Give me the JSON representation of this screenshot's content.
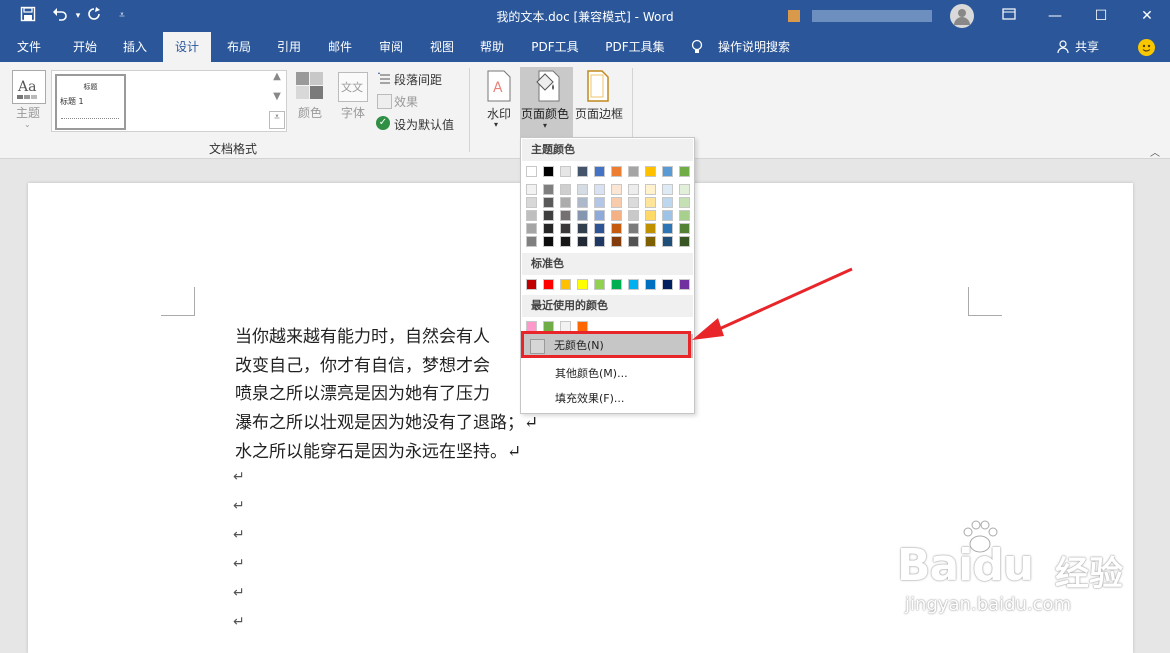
{
  "titlebar": {
    "title": "我的文本.doc [兼容模式] - Word",
    "save_icon": "save-icon",
    "undo_icon": "undo-icon",
    "redo_icon": "redo-icon",
    "customize_icon": "customize-qat-icon"
  },
  "menu": {
    "tabs": [
      "文件",
      "开始",
      "插入",
      "设计",
      "布局",
      "引用",
      "邮件",
      "审阅",
      "视图",
      "帮助",
      "PDF工具",
      "PDF工具集"
    ],
    "active": "设计",
    "tell_me": "操作说明搜索",
    "share": "共享"
  },
  "ribbon": {
    "theme_label": "主题",
    "style_preview_title": "标题",
    "style_preview_heading": "标题 1",
    "colors_label": "颜色",
    "fonts_label": "字体",
    "paragraph_spacing": "段落间距",
    "effects": "效果",
    "set_default": "设为默认值",
    "group_label": "文档格式",
    "watermark": "水印",
    "page_color": "页面颜色",
    "page_borders": "页面边框"
  },
  "dropdown": {
    "theme_colors_header": "主题颜色",
    "standard_colors_header": "标准色",
    "recent_colors_header": "最近使用的颜色",
    "no_color": "无颜色(N)",
    "more_colors": "其他颜色(M)...",
    "fill_effects": "填充效果(F)...",
    "theme_top_row": [
      "#ffffff",
      "#000000",
      "#e7e6e6",
      "#44546a",
      "#4472c4",
      "#ed7d31",
      "#a5a5a5",
      "#ffc000",
      "#5b9bd5",
      "#70ad47"
    ],
    "theme_shades": [
      [
        "#f2f2f2",
        "#d8d8d8",
        "#bfbfbf",
        "#a5a5a5",
        "#7f7f7f"
      ],
      [
        "#7f7f7f",
        "#595959",
        "#3f3f3f",
        "#262626",
        "#0c0c0c"
      ],
      [
        "#d0cece",
        "#aeabab",
        "#757171",
        "#3a3838",
        "#171616"
      ],
      [
        "#d6dce4",
        "#adb9ca",
        "#8496b0",
        "#323f4f",
        "#222a35"
      ],
      [
        "#d9e2f3",
        "#b4c6e7",
        "#8eaadb",
        "#2f5496",
        "#1f3864"
      ],
      [
        "#fbe5d5",
        "#f7cbac",
        "#f4b183",
        "#c55a11",
        "#833c0b"
      ],
      [
        "#ededed",
        "#dbdbdb",
        "#c9c9c9",
        "#7b7b7b",
        "#525252"
      ],
      [
        "#fff2cc",
        "#fee599",
        "#ffd965",
        "#bf9000",
        "#7f6000"
      ],
      [
        "#deebf6",
        "#bdd7ee",
        "#9dc3e6",
        "#2e75b5",
        "#1f4e79"
      ],
      [
        "#e2efd9",
        "#c5e0b3",
        "#a8d08d",
        "#538135",
        "#375623"
      ]
    ],
    "standard_colors": [
      "#c00000",
      "#ff0000",
      "#ffc000",
      "#ffff00",
      "#92d050",
      "#00b050",
      "#00b0f0",
      "#0070c0",
      "#002060",
      "#7030a0"
    ],
    "recent_colors": [
      "#ff99cc",
      "#70ad47",
      "#f2f2f2",
      "#ff6600"
    ]
  },
  "document": {
    "lines": [
      "当你越来越有能力时，自然会有人",
      "改变自己，你才有自信，梦想才会",
      "喷泉之所以漂亮是因为她有了压力",
      "瀑布之所以壮观是因为她没有了退路；↵",
      "水之所以能穿石是因为永远在坚持。↵"
    ],
    "para_mark": "↵"
  },
  "watermark": {
    "brand": "Bai",
    "brand2": "du",
    "brand_cn": "经验",
    "url": "jingyan.baidu.com"
  },
  "colors": {
    "accent": "#2b579a",
    "highlight_red": "#e8262a"
  }
}
